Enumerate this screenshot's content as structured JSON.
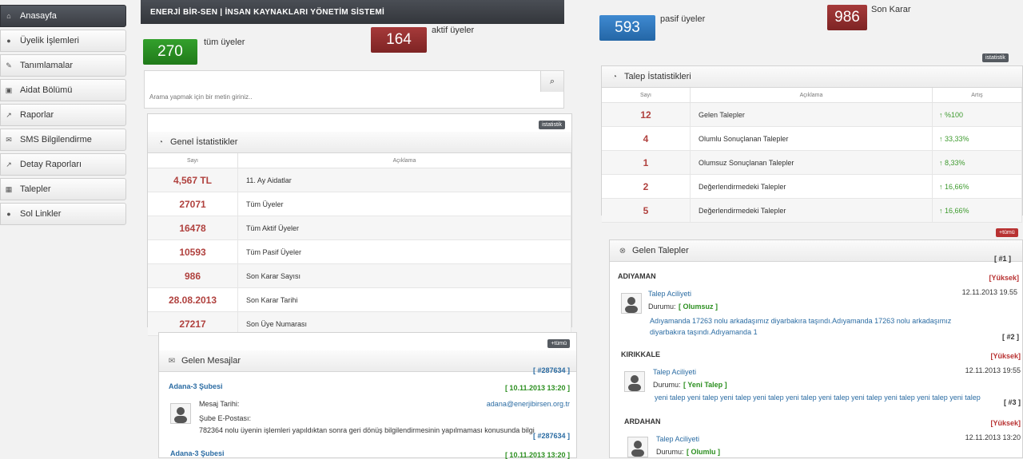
{
  "sidebar": {
    "items": [
      {
        "label": "Anasayfa",
        "icon": "home-icon"
      },
      {
        "label": "Üyelik İşlemleri",
        "icon": "user-icon"
      },
      {
        "label": "Tanımlamalar",
        "icon": "edit-icon"
      },
      {
        "label": "Aidat Bölümü",
        "icon": "picture-icon"
      },
      {
        "label": "Raporlar",
        "icon": "chart-icon"
      },
      {
        "label": "SMS Bilgilendirme",
        "icon": "chat-icon"
      },
      {
        "label": "Detay Raporları",
        "icon": "chart-icon"
      },
      {
        "label": "Talepler",
        "icon": "calendar-icon"
      },
      {
        "label": "Sol Linkler",
        "icon": "user-icon"
      }
    ]
  },
  "header": {
    "title": "ENERJİ BİR-SEN | İNSAN KAYNAKLARI YÖNETİM SİSTEMİ"
  },
  "stats": [
    {
      "value": "270",
      "label": "tüm üyeler",
      "color": "#2a8e23"
    },
    {
      "value": "164",
      "label": "aktif üyeler",
      "color": "#943030"
    },
    {
      "value": "593",
      "label": "pasif üyeler",
      "color": "#2f78be"
    },
    {
      "value": "986",
      "label": "Son Karar",
      "color": "#943030"
    }
  ],
  "search": {
    "placeholder": "Arama yapmak için bir metin giriniz.."
  },
  "general_stats": {
    "title": "Genel İstatistikler",
    "badge": "istatistik",
    "col_count": "Sayı",
    "col_desc": "Açıklama",
    "rows": [
      {
        "value": "4,567 TL",
        "desc": "11. Ay Aidatlar"
      },
      {
        "value": "27071",
        "desc": "Tüm Üyeler"
      },
      {
        "value": "16478",
        "desc": "Tüm Aktif Üyeler"
      },
      {
        "value": "10593",
        "desc": "Tüm Pasif Üyeler"
      },
      {
        "value": "986",
        "desc": "Son Karar Sayısı"
      },
      {
        "value": "28.08.2013",
        "desc": "Son Karar Tarihi"
      },
      {
        "value": "27217",
        "desc": "Son Üye Numarası"
      }
    ]
  },
  "request_stats": {
    "title": "Talep İstatistikleri",
    "badge": "istatistik",
    "col_count": "Sayı",
    "col_desc": "Açıklama",
    "col_trend": "Artış",
    "rows": [
      {
        "value": "12",
        "desc": "Gelen Talepler",
        "trend": "↑ %100"
      },
      {
        "value": "4",
        "desc": "Olumlu Sonuçlanan Talepler",
        "trend": "↑ 33,33%"
      },
      {
        "value": "1",
        "desc": "Olumsuz Sonuçlanan Talepler",
        "trend": "↑ 8,33%"
      },
      {
        "value": "2",
        "desc": "Değerlendirmedeki Talepler",
        "trend": "↑ 16,66%"
      },
      {
        "value": "5",
        "desc": "Değerlendirmedeki Talepler",
        "trend": "↑ 16,66%"
      }
    ]
  },
  "messages": {
    "title": "Gelen Mesajlar",
    "badge": "+tümü",
    "items": [
      {
        "id": "[ #287634 ]",
        "branch": "Adana-3 Şubesi",
        "date": "[ 10.11.2013 13:20 ]",
        "date_label": "Mesaj Tarihi:",
        "email_label": "Şube E-Postası:",
        "email": "adana@enerjibirsen.org.tr",
        "body": "782364 nolu üyenin işlemleri yapıldıktan sonra geri dönüş bilgilendirmesinin yapılmaması konusunda bilgi"
      },
      {
        "id": "[ #287634 ]",
        "branch": "Adana-3 Şubesi",
        "date": "[ 10.11.2013 13:20 ]"
      }
    ]
  },
  "requests": {
    "title": "Gelen Talepler",
    "badge": "+tümü",
    "items": [
      {
        "num": "[ #1 ]",
        "city": "ADIYAMAN",
        "priority": "[Yüksek]",
        "subject": "Talep Aciliyeti",
        "date": "12.11.2013 19.55",
        "status_label": "Durumu:",
        "status": "[ Olumsuz ]",
        "body": "Adıyamanda 17263 nolu arkadaşımız diyarbakıra taşındı.Adıyamanda 17263 nolu arkadaşımız diyarbakıra taşındı.Adıyamanda 1"
      },
      {
        "num": "[ #2 ]",
        "city": "KIRIKKALE",
        "priority": "[Yüksek]",
        "subject": "Talep Aciliyeti",
        "date": "12.11.2013 19:55",
        "status_label": "Durumu:",
        "status": "[ Yeni Talep ]",
        "body": "yeni talep yeni talep yeni talep yeni talep yeni talep yeni talep yeni talep yeni talep yeni talep yeni talep"
      },
      {
        "num": "[ #3 ]",
        "city": "ARDAHAN",
        "priority": "[Yüksek]",
        "subject": "Talep Aciliyeti",
        "date": "12.11.2013 13:20",
        "status_label": "Durumu:",
        "status": "[ Olumlu ]"
      }
    ]
  }
}
